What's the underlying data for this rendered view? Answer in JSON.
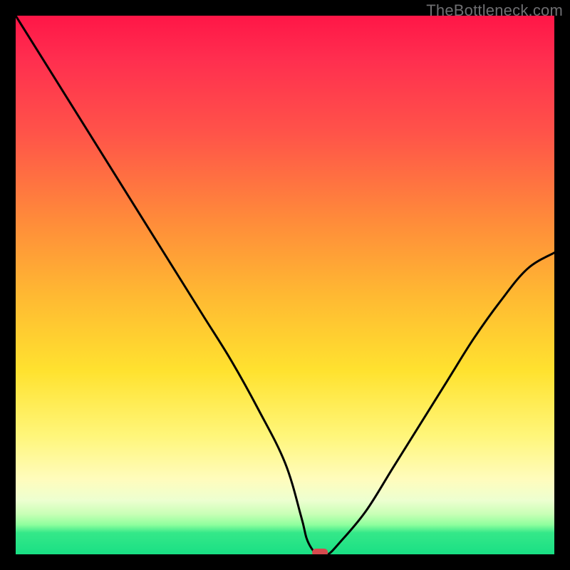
{
  "watermark": "TheBottleneck.com",
  "chart_data": {
    "type": "line",
    "title": "",
    "xlabel": "",
    "ylabel": "",
    "xlim": [
      0,
      100
    ],
    "ylim": [
      0,
      100
    ],
    "grid": false,
    "legend": false,
    "series": [
      {
        "name": "bottleneck-curve",
        "x": [
          0,
          5,
          10,
          15,
          20,
          25,
          30,
          35,
          40,
          45,
          50,
          53,
          54,
          55,
          56,
          57,
          58,
          60,
          65,
          70,
          75,
          80,
          85,
          90,
          95,
          100
        ],
        "values": [
          100,
          92,
          84,
          76,
          68,
          60,
          52,
          44,
          36,
          27,
          17,
          7,
          3,
          1,
          0,
          0,
          0,
          2,
          8,
          16,
          24,
          32,
          40,
          47,
          53,
          56
        ]
      }
    ],
    "markers": [
      {
        "name": "min-marker",
        "x": 56.5,
        "y": 0,
        "color": "#d64a4e"
      }
    ],
    "gradient_stops": [
      {
        "pos": 0.0,
        "color": "#ff1647"
      },
      {
        "pos": 0.38,
        "color": "#ff8b3a"
      },
      {
        "pos": 0.66,
        "color": "#ffe22f"
      },
      {
        "pos": 0.9,
        "color": "#edffd0"
      },
      {
        "pos": 0.96,
        "color": "#35e889"
      },
      {
        "pos": 1.0,
        "color": "#19df84"
      }
    ]
  }
}
